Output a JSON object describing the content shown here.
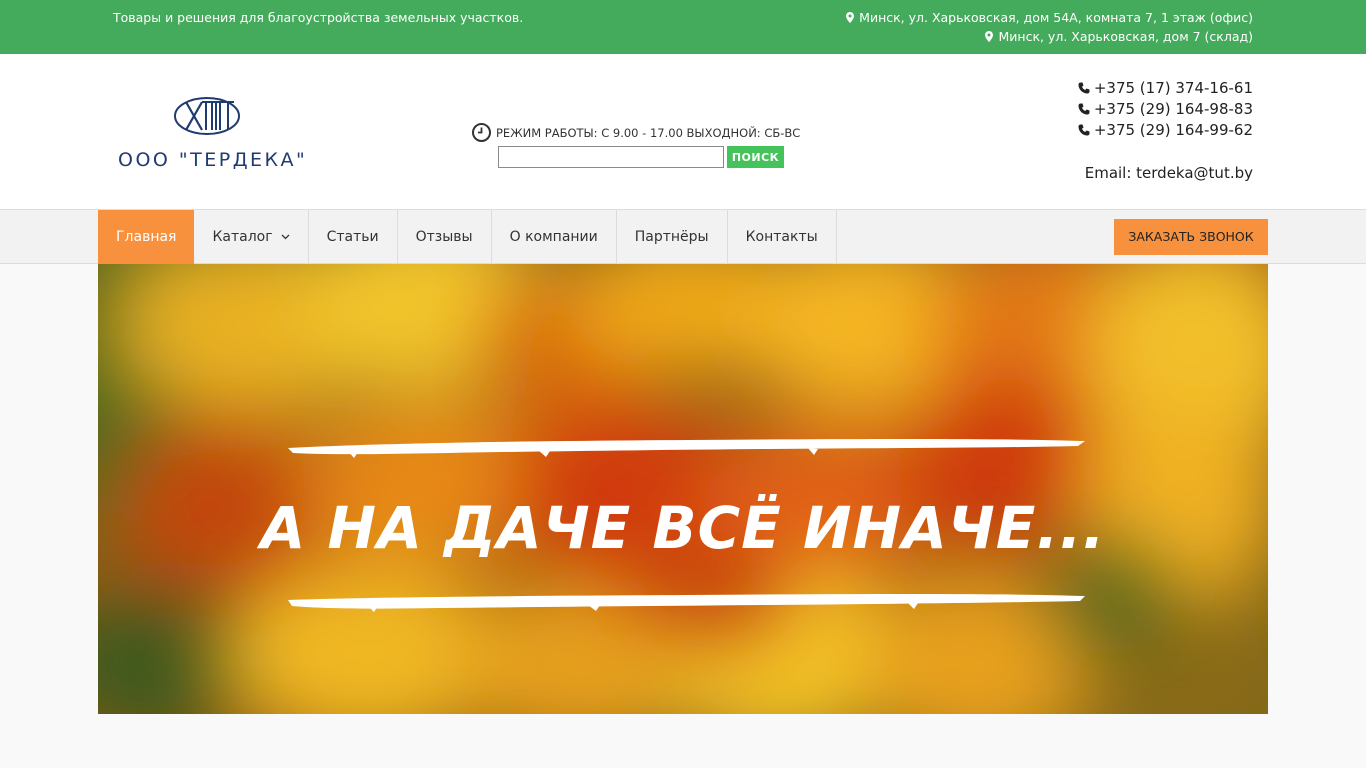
{
  "topbar": {
    "tagline": "Товары и решения для благоустройства земельных участков.",
    "address_office": "Минск, ул. Харьковская, дом 54А, комната 7, 1 этаж (офис)",
    "address_warehouse": "Минск, ул. Харьковская, дом 7 (склад)"
  },
  "header": {
    "logo_text": "ООО \"ТЕРДЕКА\"",
    "hours": "РЕЖИМ РАБОТЫ: С 9.00 - 17.00 ВЫХОДНОЙ: СБ-ВС",
    "search": {
      "value": "",
      "placeholder": "",
      "button_label": "ПОИСК"
    },
    "phones": [
      "+375 (17) 374-16-61",
      "+375 (29) 164-98-83",
      "+375 (29) 164-99-62"
    ],
    "email": "Email: terdeka@tut.by"
  },
  "nav": {
    "items": [
      {
        "label": "Главная",
        "active": true
      },
      {
        "label": "Каталог",
        "has_dropdown": true
      },
      {
        "label": "Статьи"
      },
      {
        "label": "Отзывы"
      },
      {
        "label": "О компании"
      },
      {
        "label": "Партнёры"
      },
      {
        "label": "Контакты"
      }
    ],
    "call_button": "ЗАКАЗАТЬ ЗВОНОК"
  },
  "hero": {
    "title": "А НА ДАЧЕ ВСЁ ИНАЧЕ..."
  },
  "colors": {
    "green": "#45ab5c",
    "orange": "#f7913d",
    "search_green": "#45c35b",
    "logo_blue": "#1f3b70"
  }
}
